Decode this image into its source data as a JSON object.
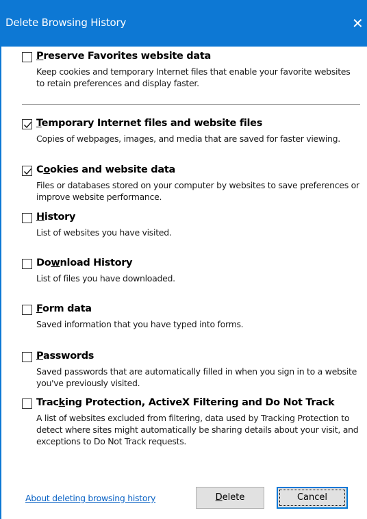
{
  "window": {
    "title": "Delete Browsing History",
    "close_glyph": "✕"
  },
  "options": [
    {
      "label": "Preserve Favorites website data",
      "accesskey": "P",
      "checked": false,
      "description": "Keep cookies and temporary Internet files that enable your favorite websites to retain preferences and display faster."
    },
    {
      "label": "Temporary Internet files and website files",
      "accesskey": "T",
      "checked": true,
      "description": "Copies of webpages, images, and media that are saved for faster viewing."
    },
    {
      "label": "Cookies and website data",
      "accesskey": "o",
      "checked": true,
      "description": "Files or databases stored on your computer by websites to save preferences or improve website performance."
    },
    {
      "label": "History",
      "accesskey": "H",
      "checked": false,
      "description": "List of websites you have visited."
    },
    {
      "label": "Download History",
      "accesskey": "w",
      "checked": false,
      "description": "List of files you have downloaded."
    },
    {
      "label": "Form data",
      "accesskey": "F",
      "checked": false,
      "description": "Saved information that you have typed into forms."
    },
    {
      "label": "Passwords",
      "accesskey": "P",
      "checked": false,
      "description": "Saved passwords that are automatically filled in when you sign in to a website you've previously visited."
    },
    {
      "label": "Tracking Protection, ActiveX Filtering and Do Not Track",
      "accesskey": "k",
      "checked": false,
      "description": "A list of websites excluded from filtering, data used by Tracking Protection to detect where sites might automatically be sharing details about your visit, and exceptions to Do Not Track requests."
    }
  ],
  "footer": {
    "link_text": "About deleting browsing history",
    "delete_label": "Delete",
    "cancel_label": "Cancel"
  },
  "colors": {
    "titlebar": "#0d78d4",
    "link": "#0b63c5",
    "focus_border": "#0078d7"
  }
}
